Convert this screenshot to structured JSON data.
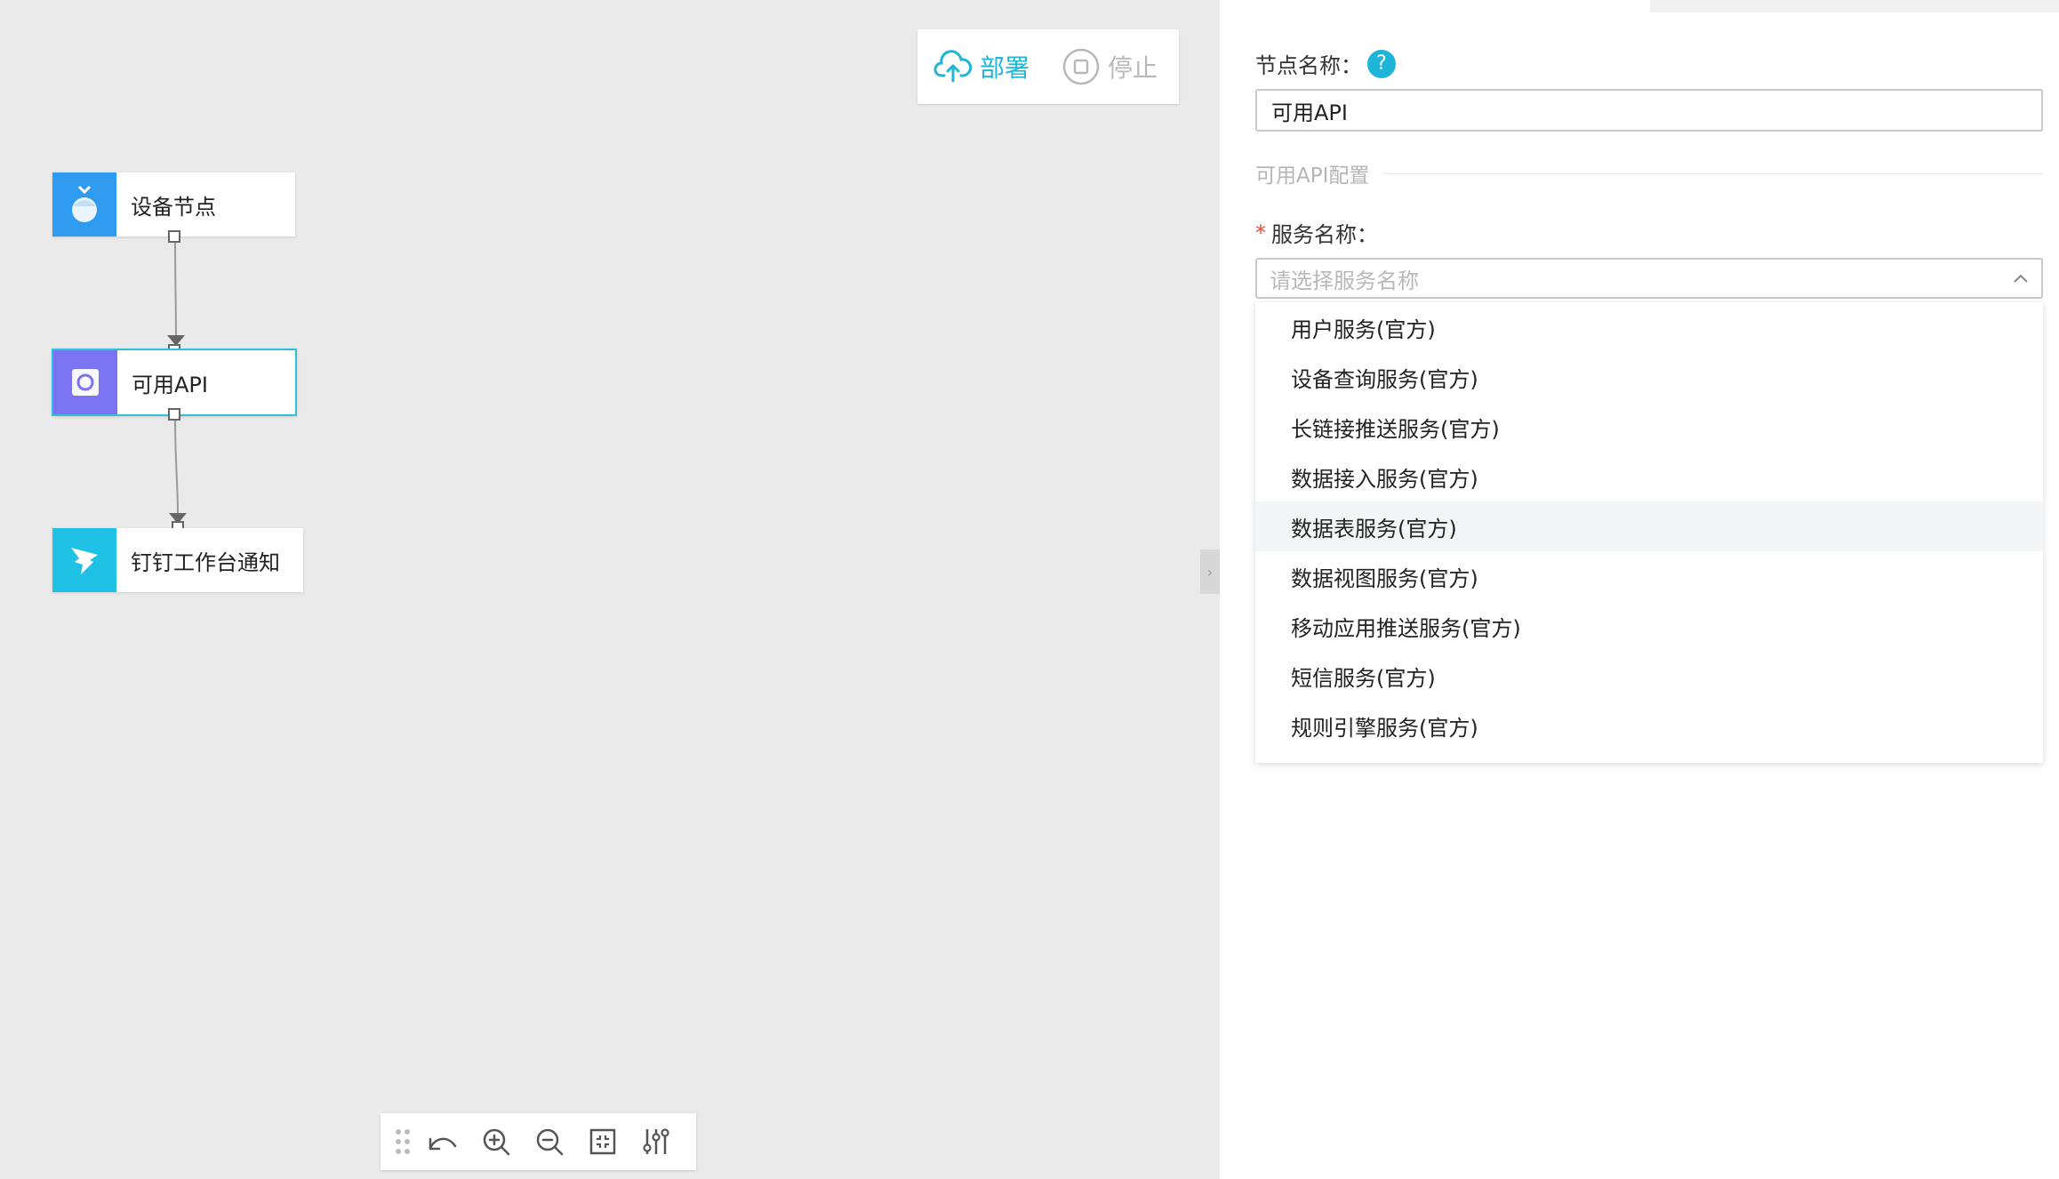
{
  "toolbar_top": {
    "deploy_label": "部署",
    "stop_label": "停止"
  },
  "nodes": [
    {
      "label": "设备节点",
      "icon": "device-icon",
      "color": "#2e9bf0"
    },
    {
      "label": "可用API",
      "icon": "api-icon",
      "color": "#7a74f2"
    },
    {
      "label": "钉钉工作台通知",
      "icon": "dingtalk-icon",
      "color": "#1fc2e5"
    }
  ],
  "panel": {
    "node_name_label": "节点名称：",
    "help_symbol": "?",
    "node_name_value": "可用API",
    "section_title": "可用API配置",
    "required_mark": "*",
    "service_label": "服务名称：",
    "service_placeholder": "请选择服务名称",
    "service_options": [
      "用户服务(官方)",
      "设备查询服务(官方)",
      "长链接推送服务(官方)",
      "数据接入服务(官方)",
      "数据表服务(官方)",
      "数据视图服务(官方)",
      "移动应用推送服务(官方)",
      "短信服务(官方)",
      "规则引擎服务(官方)"
    ],
    "hovered_option_index": 4
  },
  "colors": {
    "accent": "#1fb5d8",
    "required": "#e64a3b",
    "canvas_bg": "#eaeaea"
  }
}
